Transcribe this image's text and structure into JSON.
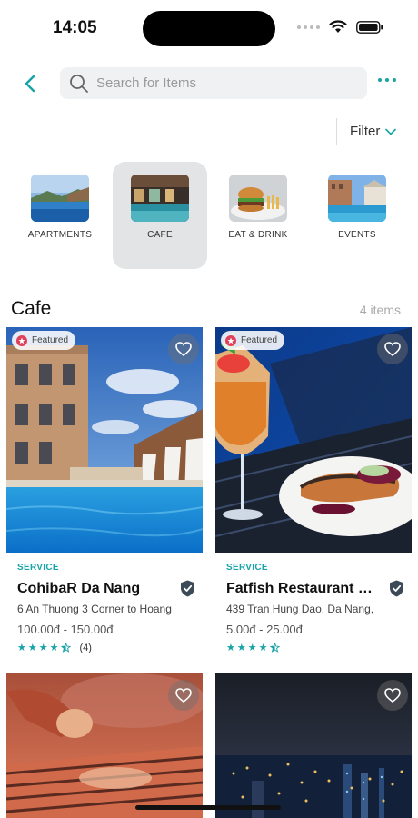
{
  "status_bar": {
    "time": "14:05"
  },
  "search": {
    "placeholder": "Search for Items"
  },
  "filter": {
    "label": "Filter"
  },
  "categories": [
    {
      "label": "APARTMENTS",
      "icon": "apartment-photo"
    },
    {
      "label": "CAFE",
      "icon": "cafe-photo",
      "active": true
    },
    {
      "label": "EAT & DRINK",
      "icon": "burger-photo"
    },
    {
      "label": "EVENTS",
      "icon": "events-photo"
    }
  ],
  "section": {
    "title": "Cafe",
    "count": "4 items"
  },
  "cards": [
    {
      "badge": "Featured",
      "category": "SERVICE",
      "title": "CohibaR Da Nang",
      "address": "6 An Thuong 3 Corner to Hoang",
      "price": "100.00đ - 150.00đ",
      "rating": 4.5,
      "rating_count": "(4)"
    },
    {
      "badge": "Featured",
      "category": "SERVICE",
      "title": "Fatfish Restaurant & L...",
      "address": "439 Tran Hung Dao, Da Nang,",
      "price": "5.00đ - 25.00đ",
      "rating": 4.5
    }
  ],
  "colors": {
    "accent": "#17a3a8",
    "badge_icon": "#e0405a"
  }
}
